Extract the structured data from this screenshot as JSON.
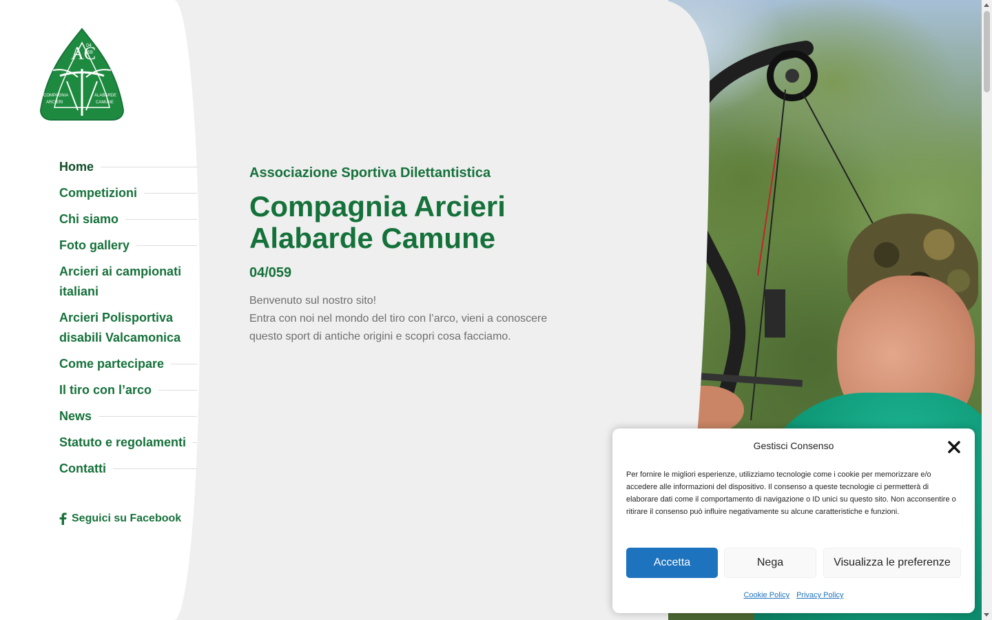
{
  "site": {
    "logo_alt": "Compagnia Arcieri Alabarde Camune",
    "logo_text": {
      "left": "COMPAGNIA ARCIERI",
      "right": "ALABARDE CAMUNE",
      "number_top": "04",
      "number_bottom": "059",
      "monogram": "AC"
    }
  },
  "nav": {
    "items": [
      {
        "label": "Home"
      },
      {
        "label": "Competizioni"
      },
      {
        "label": "Chi siamo"
      },
      {
        "label": "Foto gallery"
      },
      {
        "label": "Arcieri ai campionati italiani"
      },
      {
        "label": "Arcieri Polisportiva disabili Valcamonica"
      },
      {
        "label": "Come partecipare"
      },
      {
        "label": "Il tiro con l’arco"
      },
      {
        "label": "News"
      },
      {
        "label": "Statuto e regolamenti"
      },
      {
        "label": "Contatti"
      }
    ],
    "facebook_label": "Seguici su Facebook"
  },
  "hero": {
    "subtitle": "Associazione Sportiva Dilettantistica",
    "title_line1": "Compagnia Arcieri",
    "title_line2": "Alabarde Camune",
    "code": "04/059",
    "welcome_line1": "Benvenuto sul nostro sito!",
    "welcome_line2": "Entra con noi nel mondo del tiro con l’arco, vieni a conoscere questo sport di antiche origini e scopri cosa facciamo."
  },
  "cookie": {
    "title": "Gestisci Consenso",
    "text": "Per fornire le migliori esperienze, utilizziamo tecnologie come i cookie per memorizzare e/o accedere alle informazioni del dispositivo. Il consenso a queste tecnologie ci permetterà di elaborare dati come il comportamento di navigazione o ID unici su questo sito. Non acconsentire o ritirare il consenso può influire negativamente su alcune caratteristiche e funzioni.",
    "accept_label": "Accetta",
    "deny_label": "Nega",
    "prefs_label": "Visualizza le preferenze",
    "cookie_policy_label": "Cookie Policy",
    "privacy_policy_label": "Privacy Policy"
  },
  "colors": {
    "brand_green": "#15713a",
    "accent_blue": "#1e73be",
    "panel_grey": "#efefef"
  },
  "icons": {
    "facebook": "facebook-icon",
    "close": "close-icon"
  }
}
